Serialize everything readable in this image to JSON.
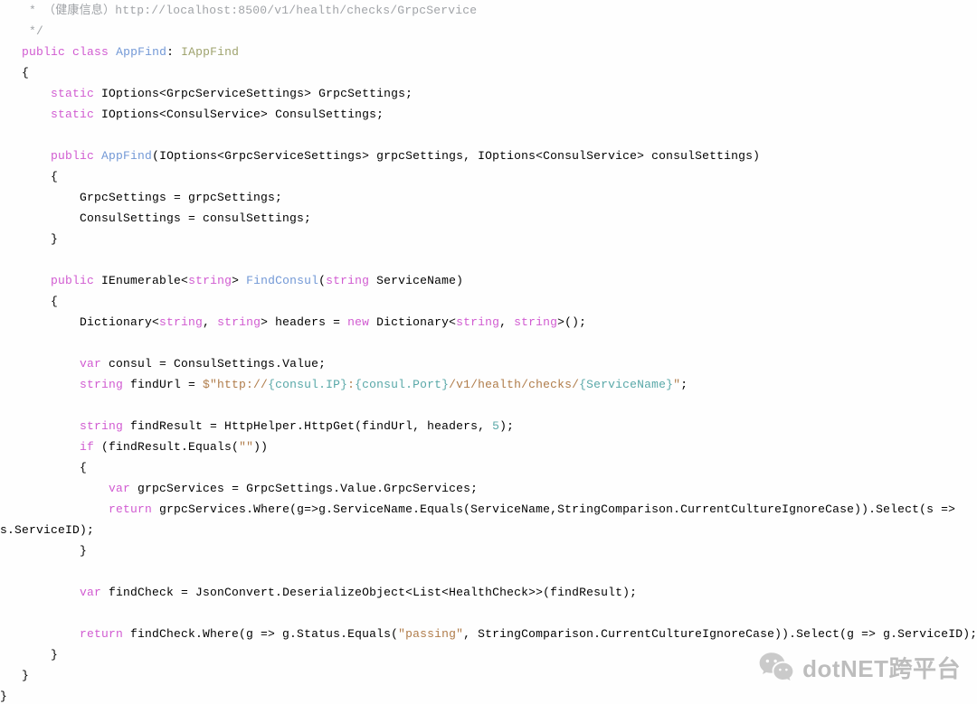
{
  "code": {
    "L01_a": "    * （健康信息）",
    "L01_b": "http://localhost:8500/v1/health/checks/GrpcService",
    "L02": "    */",
    "L03_a": "   ",
    "L03_b": "public",
    "L03_c": " ",
    "L03_d": "class",
    "L03_e": " ",
    "L03_f": "AppFind",
    "L03_g": ": ",
    "L03_h": "IAppFind",
    "L04": "   {",
    "L05_a": "       ",
    "L05_b": "static",
    "L05_c": " IOptions<GrpcServiceSettings> GrpcSettings;",
    "L06_a": "       ",
    "L06_b": "static",
    "L06_c": " IOptions<ConsulService> ConsulSettings;",
    "L07": "",
    "L08_a": "       ",
    "L08_b": "public",
    "L08_c": " ",
    "L08_d": "AppFind",
    "L08_e": "(IOptions<GrpcServiceSettings> grpcSettings, IOptions<ConsulService> consulSettings)",
    "L09": "       {",
    "L10": "           GrpcSettings = grpcSettings;",
    "L11": "           ConsulSettings = consulSettings;",
    "L12": "       }",
    "L13": "",
    "L14_a": "       ",
    "L14_b": "public",
    "L14_c": " IEnumerable<",
    "L14_d": "string",
    "L14_e": "> ",
    "L14_f": "FindConsul",
    "L14_g": "(",
    "L14_h": "string",
    "L14_i": " ServiceName)",
    "L15": "       {",
    "L16_a": "           Dictionary<",
    "L16_b": "string",
    "L16_c": ", ",
    "L16_d": "string",
    "L16_e": "> headers = ",
    "L16_f": "new",
    "L16_g": " Dictionary<",
    "L16_h": "string",
    "L16_i": ", ",
    "L16_j": "string",
    "L16_k": ">();",
    "L17": "",
    "L18_a": "           ",
    "L18_b": "var",
    "L18_c": " consul = ConsulSettings.Value;",
    "L19_a": "           ",
    "L19_b": "string",
    "L19_c": " findUrl = ",
    "L19_d": "$\"http://",
    "L19_e": "{consul.IP}",
    "L19_f": ":",
    "L19_g": "{consul.Port}",
    "L19_h": "/v1/health/checks/",
    "L19_i": "{ServiceName}",
    "L19_j": "\"",
    "L19_k": ";",
    "L20": "",
    "L21_a": "           ",
    "L21_b": "string",
    "L21_c": " findResult = HttpHelper.HttpGet(findUrl, headers, ",
    "L21_d": "5",
    "L21_e": ");",
    "L22_a": "           ",
    "L22_b": "if",
    "L22_c": " (findResult.Equals(",
    "L22_d": "\"\"",
    "L22_e": "))",
    "L23": "           {",
    "L24_a": "               ",
    "L24_b": "var",
    "L24_c": " grpcServices = GrpcSettings.Value.GrpcServices;",
    "L25_a": "               ",
    "L25_b": "return",
    "L25_c": " grpcServices.Where(g=>g.ServiceName.Equals(ServiceName,StringComparison.CurrentCultureIgnoreCase)).Select(s => ",
    "L25_d": "s.ServiceID);",
    "L26": "           }",
    "L27": "",
    "L28_a": "           ",
    "L28_b": "var",
    "L28_c": " findCheck = JsonConvert.DeserializeObject<List<HealthCheck>>(findResult);",
    "L29": "",
    "L30_a": "           ",
    "L30_b": "return",
    "L30_c": " findCheck.Where(g => g.Status.Equals(",
    "L30_d": "\"passing\"",
    "L30_e": ", StringComparison.CurrentCultureIgnoreCase)).Select(g => g.ServiceID);",
    "L31": "       }",
    "L32": "   }",
    "L33": "}"
  },
  "watermark": {
    "text": "dotNET跨平台"
  }
}
